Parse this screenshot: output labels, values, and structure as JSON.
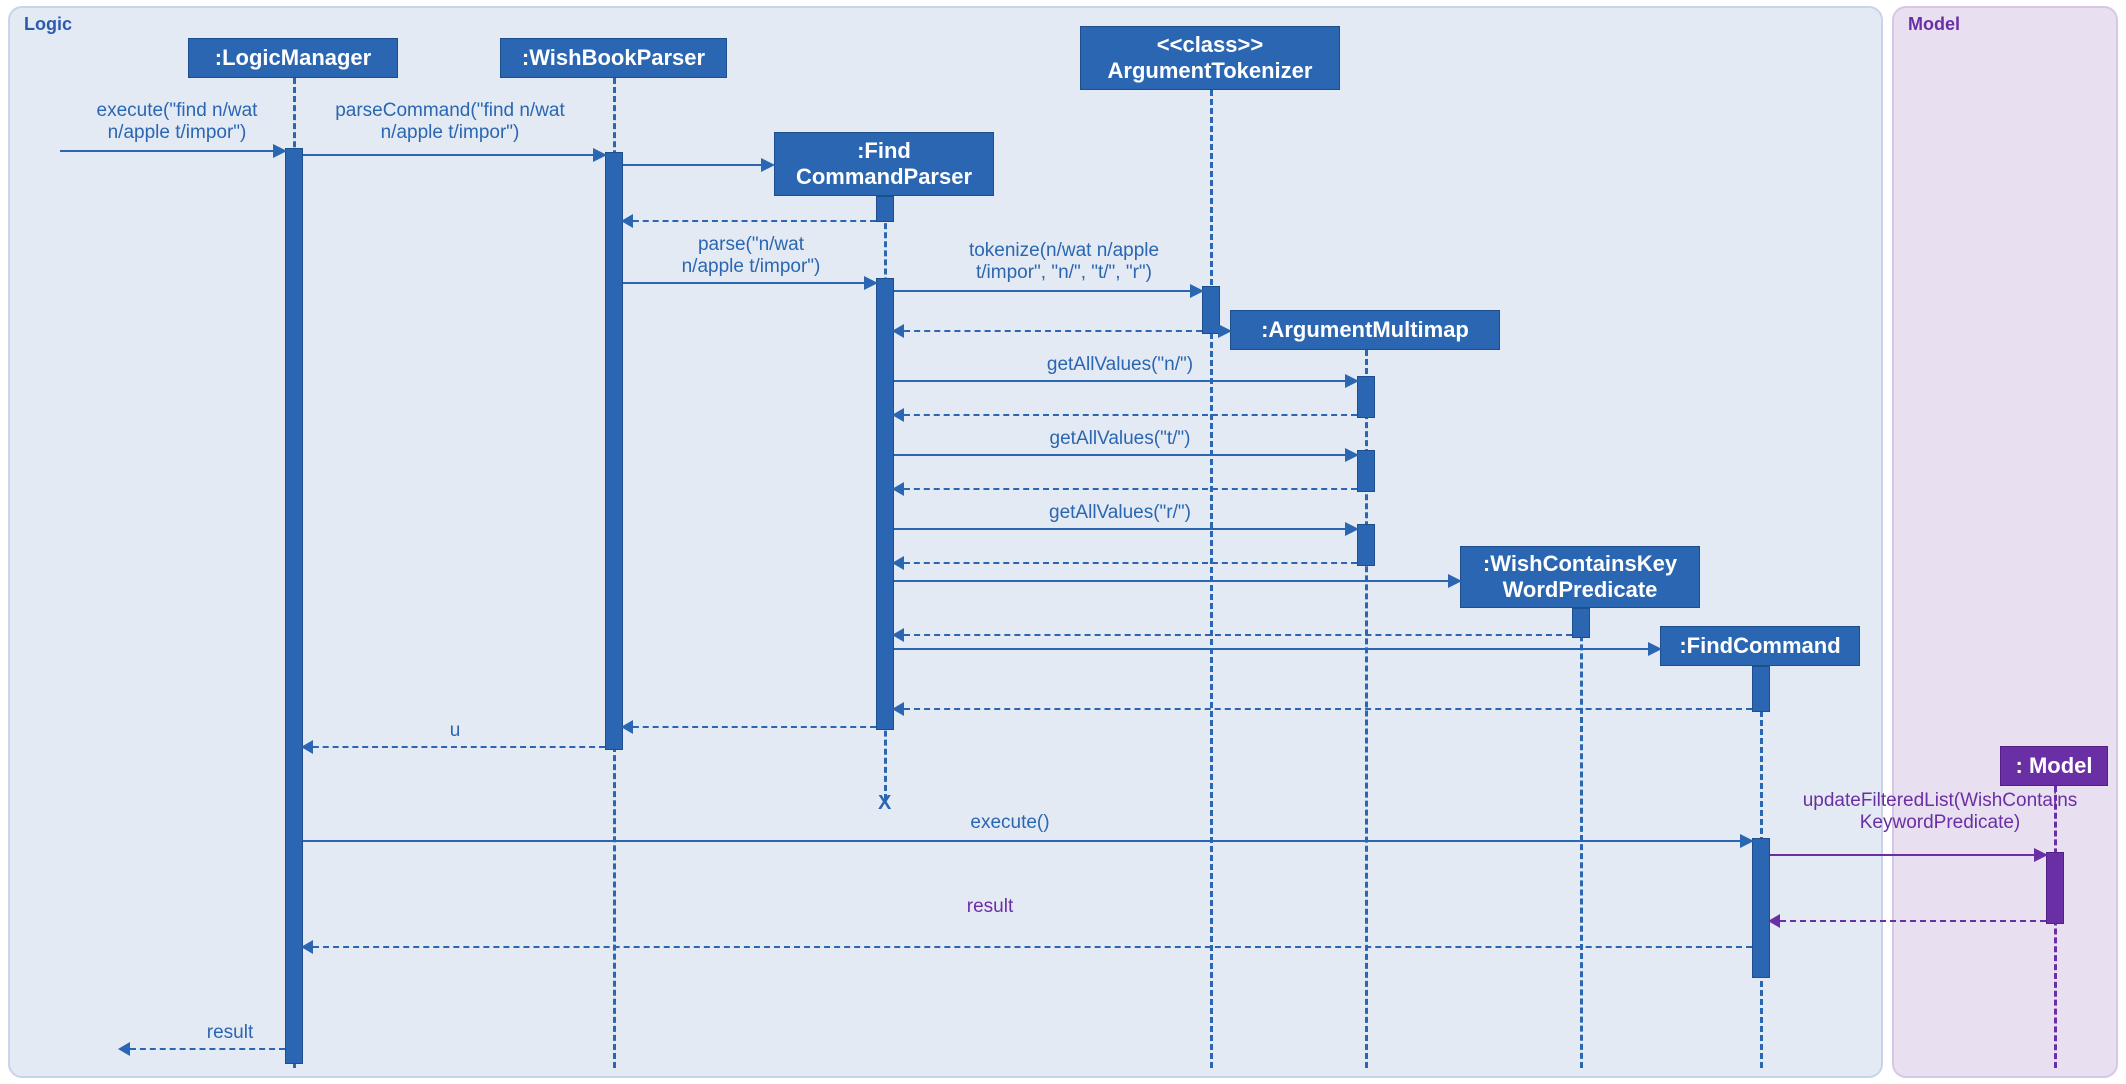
{
  "panels": {
    "logic": "Logic",
    "model": "Model"
  },
  "heads": {
    "logicManager": ":LogicManager",
    "wishBookParser": ":WishBookParser",
    "argumentTokenizer_stereo": "<<class>>",
    "argumentTokenizer": "ArgumentTokenizer",
    "findCommandParser_l1": ":Find",
    "findCommandParser_l2": "CommandParser",
    "argumentMultimap": ":ArgumentMultimap",
    "wishContainsKeyword_l1": ":WishContainsKey",
    "wishContainsKeyword_l2": "WordPredicate",
    "findCommand": ":FindCommand",
    "model": ": Model"
  },
  "messages": {
    "execute_in_l1": "execute(\"find n/wat",
    "execute_in_l2": "n/apple t/impor\")",
    "parseCommand_l1": "parseCommand(\"find n/wat",
    "parseCommand_l2": "n/apple t/impor\")",
    "parse_l1": "parse(\"n/wat",
    "parse_l2": "n/apple t/impor\")",
    "tokenize_l1": "tokenize(n/wat n/apple",
    "tokenize_l2": "t/impor\", \"n/\", \"t/\",  \"r\")",
    "getAllValues_n": "getAllValues(\"n/\")",
    "getAllValues_t": "getAllValues(\"t/\")",
    "getAllValues_r": "getAllValues(\"r/\")",
    "u": "u",
    "execute": "execute()",
    "updateFilteredList_l1": "updateFilteredList(WishContains",
    "updateFilteredList_l2": "KeywordPredicate)",
    "result": "result",
    "result2": "result",
    "result3": "result"
  },
  "chart_data": {
    "type": "sequence-diagram",
    "frames": [
      {
        "name": "Logic",
        "lifelines": [
          "LogicManager",
          "WishBookParser",
          "FindCommandParser",
          "ArgumentTokenizer",
          "ArgumentMultimap",
          "WishContainsKeyWordPredicate",
          "FindCommand"
        ]
      },
      {
        "name": "Model",
        "lifelines": [
          "Model"
        ]
      }
    ],
    "lifelines": [
      {
        "id": "LogicManager",
        "label": ":LogicManager",
        "preexisting": true
      },
      {
        "id": "WishBookParser",
        "label": ":WishBookParser",
        "preexisting": true
      },
      {
        "id": "ArgumentTokenizer",
        "label": "<<class>> ArgumentTokenizer",
        "preexisting": true
      },
      {
        "id": "FindCommandParser",
        "label": ":FindCommandParser",
        "created_by": "WishBookParser",
        "destroyed": true
      },
      {
        "id": "ArgumentMultimap",
        "label": ":ArgumentMultimap",
        "created_by": "ArgumentTokenizer"
      },
      {
        "id": "WishContainsKeyWordPredicate",
        "label": ":WishContainsKeyWordPredicate",
        "created_by": "FindCommandParser"
      },
      {
        "id": "FindCommand",
        "label": ":FindCommand",
        "created_by": "FindCommandParser"
      },
      {
        "id": "Model",
        "label": ": Model",
        "preexisting": true
      }
    ],
    "messages": [
      {
        "from": "external",
        "to": "LogicManager",
        "label": "execute(\"find n/wat n/apple t/impor\")",
        "type": "sync"
      },
      {
        "from": "LogicManager",
        "to": "WishBookParser",
        "label": "parseCommand(\"find n/wat n/apple t/impor\")",
        "type": "sync"
      },
      {
        "from": "WishBookParser",
        "to": "FindCommandParser",
        "label": "<<create>>",
        "type": "create"
      },
      {
        "from": "FindCommandParser",
        "to": "WishBookParser",
        "label": "",
        "type": "return"
      },
      {
        "from": "WishBookParser",
        "to": "FindCommandParser",
        "label": "parse(\"n/wat n/apple t/impor\")",
        "type": "sync"
      },
      {
        "from": "FindCommandParser",
        "to": "ArgumentTokenizer",
        "label": "tokenize(n/wat n/apple t/impor\", \"n/\", \"t/\", \"r\")",
        "type": "sync"
      },
      {
        "from": "ArgumentTokenizer",
        "to": "ArgumentMultimap",
        "label": "<<create>>",
        "type": "create"
      },
      {
        "from": "ArgumentTokenizer",
        "to": "FindCommandParser",
        "label": "",
        "type": "return"
      },
      {
        "from": "FindCommandParser",
        "to": "ArgumentMultimap",
        "label": "getAllValues(\"n/\")",
        "type": "sync"
      },
      {
        "from": "ArgumentMultimap",
        "to": "FindCommandParser",
        "label": "",
        "type": "return"
      },
      {
        "from": "FindCommandParser",
        "to": "ArgumentMultimap",
        "label": "getAllValues(\"t/\")",
        "type": "sync"
      },
      {
        "from": "ArgumentMultimap",
        "to": "FindCommandParser",
        "label": "",
        "type": "return"
      },
      {
        "from": "FindCommandParser",
        "to": "ArgumentMultimap",
        "label": "getAllValues(\"r/\")",
        "type": "sync"
      },
      {
        "from": "ArgumentMultimap",
        "to": "FindCommandParser",
        "label": "",
        "type": "return"
      },
      {
        "from": "FindCommandParser",
        "to": "WishContainsKeyWordPredicate",
        "label": "<<create>>",
        "type": "create"
      },
      {
        "from": "WishContainsKeyWordPredicate",
        "to": "FindCommandParser",
        "label": "",
        "type": "return"
      },
      {
        "from": "FindCommandParser",
        "to": "FindCommand",
        "label": "<<create>>",
        "type": "create"
      },
      {
        "from": "FindCommand",
        "to": "FindCommandParser",
        "label": "",
        "type": "return"
      },
      {
        "from": "FindCommandParser",
        "to": "WishBookParser",
        "label": "",
        "type": "return"
      },
      {
        "from": "WishBookParser",
        "to": "LogicManager",
        "label": "u",
        "type": "return"
      },
      {
        "from": "LogicManager",
        "to": "FindCommand",
        "label": "execute()",
        "type": "sync"
      },
      {
        "from": "FindCommand",
        "to": "Model",
        "label": "updateFilteredList(WishContainsKeywordPredicate)",
        "type": "sync"
      },
      {
        "from": "Model",
        "to": "FindCommand",
        "label": "result",
        "type": "return"
      },
      {
        "from": "FindCommand",
        "to": "LogicManager",
        "label": "result",
        "type": "return"
      },
      {
        "from": "LogicManager",
        "to": "external",
        "label": "result",
        "type": "return"
      }
    ]
  }
}
